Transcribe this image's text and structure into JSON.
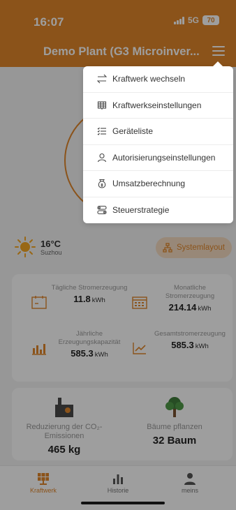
{
  "status_bar": {
    "time": "16:07",
    "network": "5G",
    "battery": "70"
  },
  "header": {
    "title": "Demo Plant (G3 Microinver..."
  },
  "menu": {
    "items": [
      {
        "label": "Kraftwerk wechseln",
        "icon": "swap-icon"
      },
      {
        "label": "Kraftwerkseinstellungen",
        "icon": "grid-settings-icon"
      },
      {
        "label": "Geräteliste",
        "icon": "list-icon"
      },
      {
        "label": "Autorisierungseinstellungen",
        "icon": "user-icon"
      },
      {
        "label": "Umsatzberechnung",
        "icon": "money-bag-icon"
      },
      {
        "label": "Steuerstrategie",
        "icon": "strategy-icon"
      }
    ]
  },
  "weather": {
    "temp": "16°C",
    "city": "Suzhou"
  },
  "layout_button": {
    "label": "Systemlayout"
  },
  "stats": {
    "daily": {
      "label": "Tägliche Stromerzeugung",
      "value": "11.8",
      "unit": "kWh"
    },
    "monthly": {
      "label": "Monatliche Stromerzeugung",
      "value": "214.14",
      "unit": "kWh"
    },
    "yearly": {
      "label": "Jährliche Erzeugungskapazität",
      "value": "585.3",
      "unit": "kWh"
    },
    "total": {
      "label": "Gesamtstromerzeugung",
      "value": "585.3",
      "unit": "kWh"
    }
  },
  "eco": {
    "co2": {
      "label": "Reduzierung der CO₂-Emissionen",
      "value": "465 kg"
    },
    "trees": {
      "label": "Bäume pflanzen",
      "value": "32 Baum"
    }
  },
  "tabs": [
    {
      "label": "Kraftwerk",
      "active": true
    },
    {
      "label": "Historie",
      "active": false
    },
    {
      "label": "meins",
      "active": false
    }
  ],
  "colors": {
    "accent": "#e0862b"
  }
}
